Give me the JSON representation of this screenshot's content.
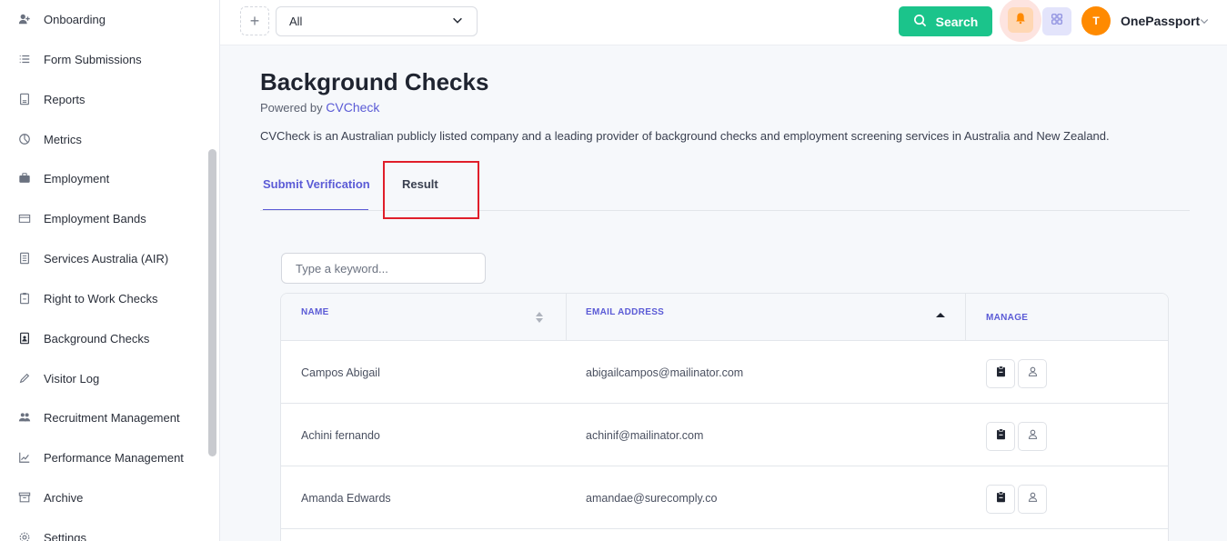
{
  "sidebar": {
    "items": [
      {
        "label": "Onboarding",
        "icon": "user-plus-icon"
      },
      {
        "label": "Form Submissions",
        "icon": "list-icon"
      },
      {
        "label": "Reports",
        "icon": "document-icon"
      },
      {
        "label": "Metrics",
        "icon": "pie-chart-icon"
      },
      {
        "label": "Employment",
        "icon": "briefcase-icon"
      },
      {
        "label": "Employment Bands",
        "icon": "folder-icon"
      },
      {
        "label": "Services Australia (AIR)",
        "icon": "file-text-icon"
      },
      {
        "label": "Right to Work Checks",
        "icon": "clipboard-icon"
      },
      {
        "label": "Background Checks",
        "icon": "id-document-icon"
      },
      {
        "label": "Visitor Log",
        "icon": "pen-icon"
      },
      {
        "label": "Recruitment Management",
        "icon": "users-icon"
      },
      {
        "label": "Performance Management",
        "icon": "trend-chart-icon"
      },
      {
        "label": "Archive",
        "icon": "archive-icon"
      },
      {
        "label": "Settings",
        "icon": "gear-icon"
      }
    ]
  },
  "header": {
    "plus": "+",
    "filter_value": "All",
    "search_label": "Search",
    "avatar_initial": "T",
    "user_name": "OnePassport"
  },
  "main": {
    "title": "Background Checks",
    "powered_prefix": "Powered by",
    "powered_brand": "CVCheck",
    "description": "CVCheck is an Australian publicly listed company and a leading provider of background checks and employment screening services in Australia and New Zealand.",
    "tabs": [
      {
        "label": "Submit Verification",
        "active": true
      },
      {
        "label": "Result",
        "active": false
      }
    ],
    "keyword_placeholder": "Type a keyword..."
  },
  "table": {
    "headers": {
      "name": "NAME",
      "email": "EMAIL ADDRESS",
      "manage": "MANAGE"
    },
    "rows": [
      {
        "name": "Campos Abigail",
        "email": "abigailcampos@mailinator.com"
      },
      {
        "name": "Achini fernando",
        "email": "achinif@mailinator.com"
      },
      {
        "name": "Amanda Edwards",
        "email": "amandae@surecomply.co"
      }
    ]
  },
  "colors": {
    "accent": "#5b5bd6",
    "search_green": "#1bc48b",
    "avatar_orange": "#ff8a00",
    "highlight_red": "#e01e2a"
  }
}
